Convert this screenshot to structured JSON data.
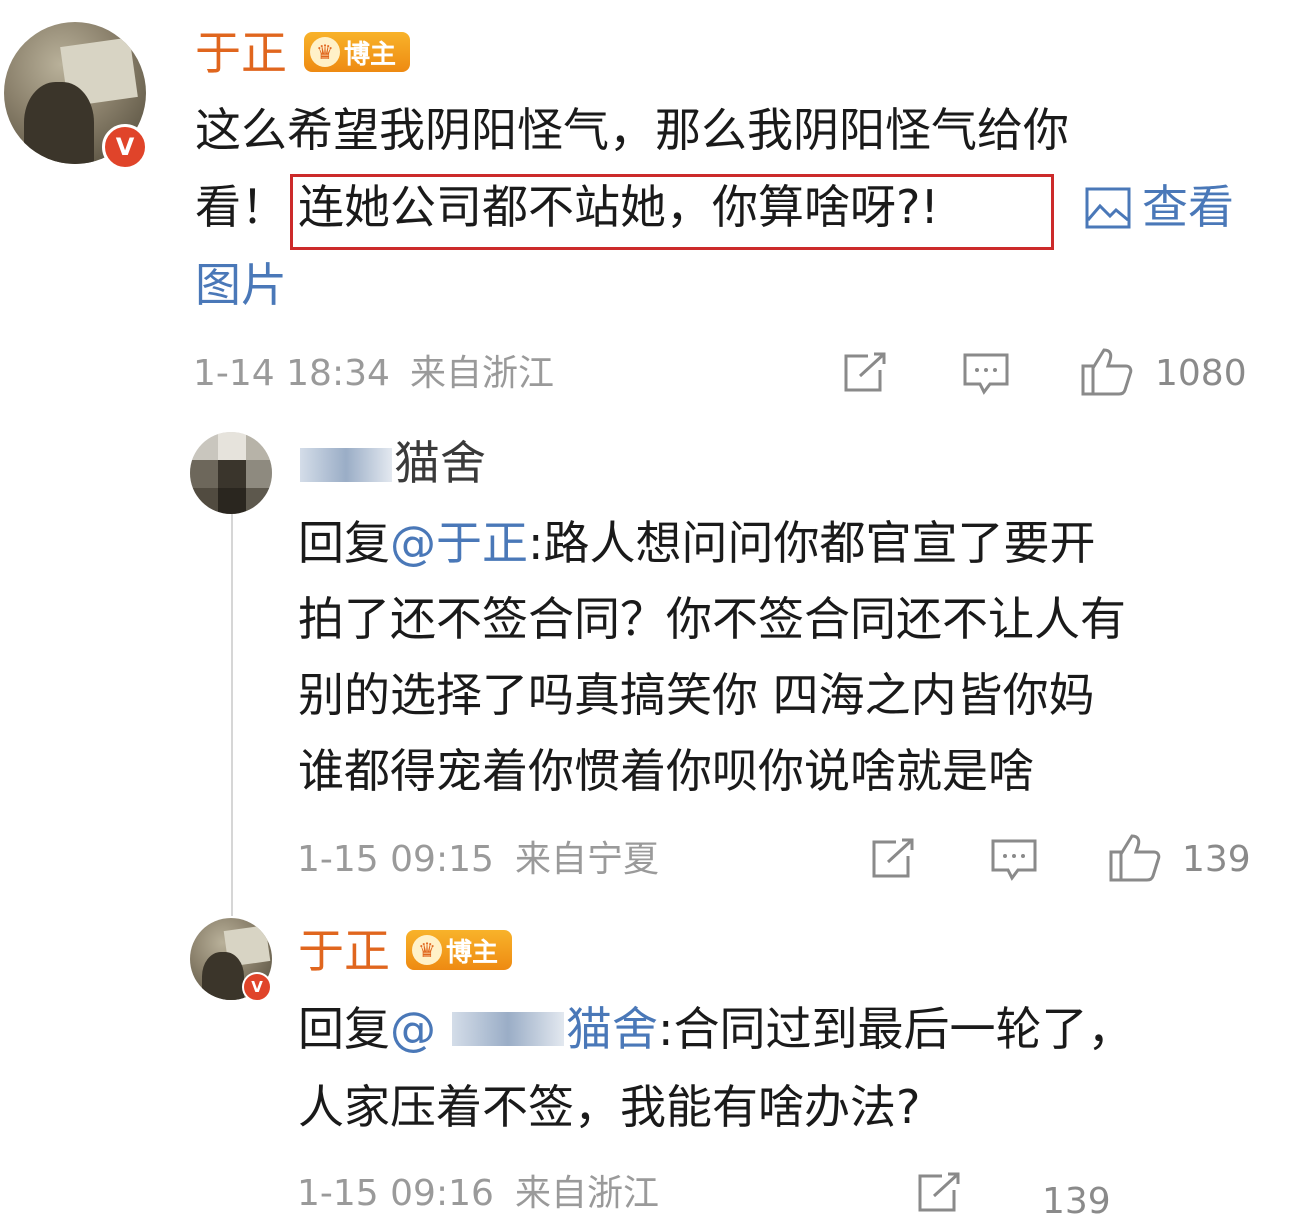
{
  "post": {
    "author": "于正",
    "badge_label": "博主",
    "verified_mark": "V",
    "line1": "这么希望我阴阳怪气，那么我阴阳怪气给你",
    "line2_prefix": "看！",
    "line2_highlight": "连她公司都不站她，你算啥呀?!",
    "view_image_part1": "查看",
    "view_image_part2": "图片",
    "timestamp": "1-14 18:34",
    "location": "来自浙江",
    "like_count": "1080"
  },
  "reply1": {
    "author_suffix": "猫舍",
    "reply_prefix": "回复",
    "mention": "@于正",
    "line1_rest": ":路人想问问你都官宣了要开",
    "line2": "拍了还不签合同？你不签合同还不让人有",
    "line3": "别的选择了吗真搞笑你 四海之内皆你妈",
    "line4": "谁都得宠着你惯着你呗你说啥就是啥",
    "timestamp": "1-15 09:15",
    "location": "来自宁夏",
    "like_count": "139"
  },
  "reply2": {
    "author": "于正",
    "badge_label": "博主",
    "verified_mark": "V",
    "reply_prefix": "回复",
    "mention_start": "@",
    "mention_end": "猫舍",
    "line1_rest": ":合同过到最后一轮了，",
    "line2": "人家压着不签，我能有啥办法?",
    "timestamp": "1-15 09:16",
    "location": "来自浙江",
    "like_count": "139"
  },
  "icons": {
    "share": "share-icon",
    "comment": "comment-icon",
    "like": "thumbs-up-icon",
    "image": "image-icon"
  },
  "colors": {
    "name_orange": "#e0661e",
    "link_blue": "#4a78b8",
    "highlight_red": "#cc2a2a",
    "meta_gray": "#9a9a9a"
  }
}
